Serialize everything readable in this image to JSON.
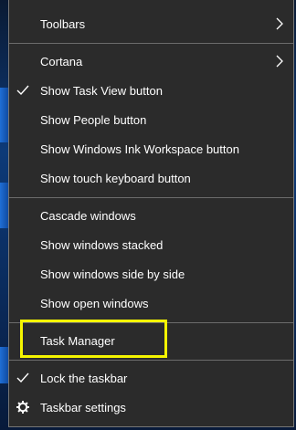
{
  "menu": {
    "items": [
      {
        "label": "Toolbars",
        "submenu": true,
        "checked": false
      },
      {
        "label": "Cortana",
        "submenu": true,
        "checked": false
      },
      {
        "label": "Show Task View button",
        "submenu": false,
        "checked": true
      },
      {
        "label": "Show People button",
        "submenu": false,
        "checked": false
      },
      {
        "label": "Show Windows Ink Workspace button",
        "submenu": false,
        "checked": false
      },
      {
        "label": "Show touch keyboard button",
        "submenu": false,
        "checked": false
      },
      {
        "label": "Cascade windows",
        "submenu": false,
        "checked": false
      },
      {
        "label": "Show windows stacked",
        "submenu": false,
        "checked": false
      },
      {
        "label": "Show windows side by side",
        "submenu": false,
        "checked": false
      },
      {
        "label": "Show open windows",
        "submenu": false,
        "checked": false
      },
      {
        "label": "Task Manager",
        "submenu": false,
        "checked": false,
        "highlighted": true
      },
      {
        "label": "Lock the taskbar",
        "submenu": false,
        "checked": true
      },
      {
        "label": "Taskbar settings",
        "submenu": false,
        "icon": "gear-icon"
      }
    ]
  },
  "colors": {
    "menu_background": "#2b2b2b",
    "menu_text": "#ffffff",
    "separator": "#6b6b6b",
    "highlight_outline": "#f5f500"
  }
}
